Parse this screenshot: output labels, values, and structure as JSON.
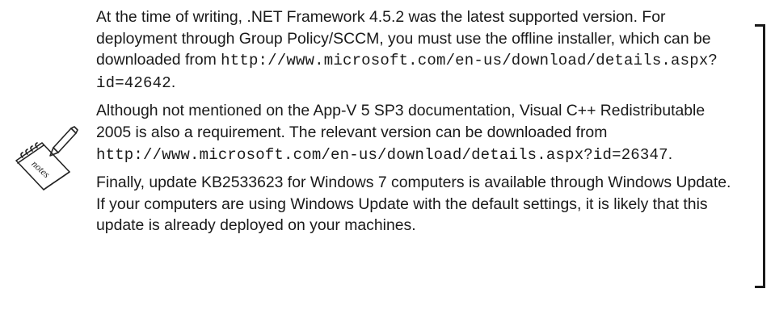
{
  "note": {
    "icon": "notes-icon",
    "icon_text": "notes",
    "paragraphs": [
      {
        "before": "At the time of writing, .NET Framework 4.5.2 was the latest supported version. For deployment through Group Policy/SCCM, you must use the offline installer, which can be downloaded from ",
        "url": "http://www.microsoft.com/en-us/download/details.aspx?id=42642",
        "after": "."
      },
      {
        "before": "Although not mentioned on the App-V 5 SP3 documentation, Visual C++ Redistributable 2005 is also a requirement. The relevant version can be downloaded from ",
        "url": "http://www.microsoft.com/en-us/download/details.aspx?id=26347",
        "after": "."
      },
      {
        "text": "Finally, update KB2533623 for Windows 7 computers is available through Windows Update. If your computers are using Windows Update with the default settings, it is likely that this update is already deployed on your machines."
      }
    ]
  }
}
